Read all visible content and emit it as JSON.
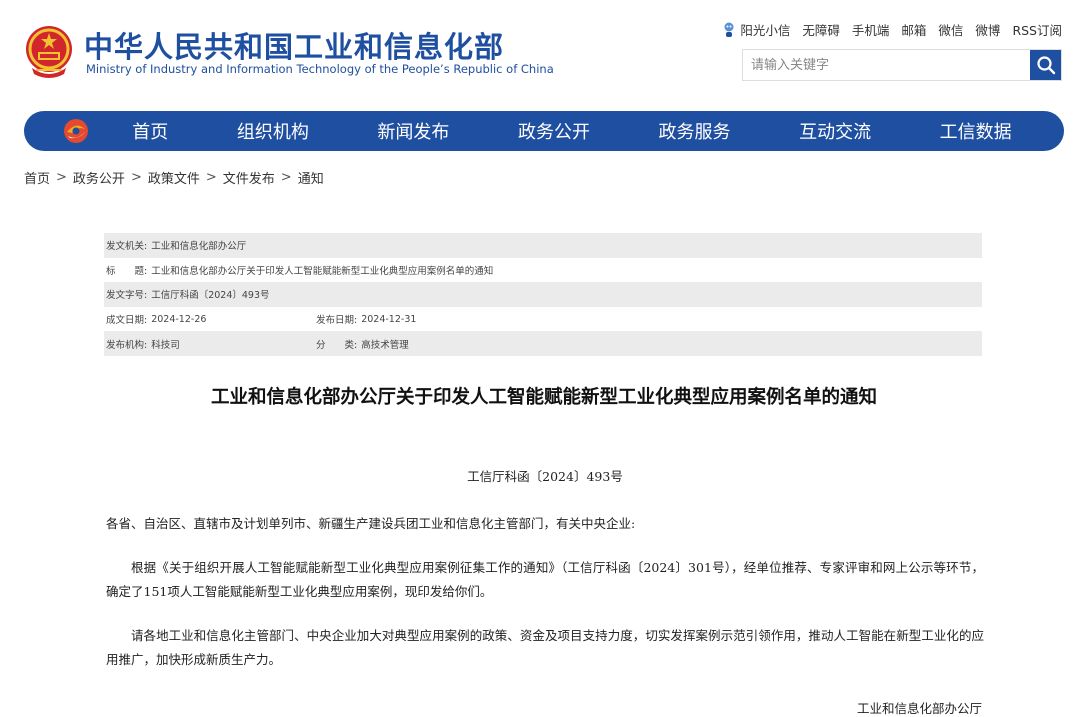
{
  "header": {
    "title": "中华人民共和国工业和信息化部",
    "subtitle": "Ministry of Industry and Information Technology of the People’s Republic of China",
    "top_links": [
      "阳光小信",
      "无障碍",
      "手机端",
      "邮箱",
      "微信",
      "微博",
      "RSS订阅"
    ],
    "search_placeholder": "请输入关键字",
    "brand_color": "#1f4fa0"
  },
  "nav": {
    "items": [
      "首页",
      "组织机构",
      "新闻发布",
      "政务公开",
      "政务服务",
      "互动交流",
      "工信数据"
    ]
  },
  "breadcrumb": [
    "首页",
    "政务公开",
    "政策文件",
    "文件发布",
    "通知"
  ],
  "meta": {
    "issuer_label": "发文机关:",
    "issuer": "工业和信息化部办公厅",
    "title_label": "标　　题:",
    "title": "工业和信息化部办公厅关于印发人工智能赋能新型工业化典型应用案例名单的通知",
    "doc_no_label": "发文字号:",
    "doc_no": "工信厅科函〔2024〕493号",
    "created_label": "成文日期:",
    "created": "2024-12-26",
    "published_label": "发布日期:",
    "published": "2024-12-31",
    "agency_label": "发布机构:",
    "agency": "科技司",
    "category_label": "分　　类:",
    "category": "高技术管理"
  },
  "document": {
    "title": "工业和信息化部办公厅关于印发人工智能赋能新型工业化典型应用案例名单的通知",
    "number": "工信厅科函〔2024〕493号",
    "salutation": "各省、自治区、直辖市及计划单列市、新疆生产建设兵团工业和信息化主管部门，有关中央企业:",
    "paragraphs": [
      "根据《关于组织开展人工智能赋能新型工业化典型应用案例征集工作的通知》（工信厅科函〔2024〕301号），经单位推荐、专家评审和网上公示等环节，确定了151项人工智能赋能新型工业化典型应用案例，现印发给你们。",
      "请各地工业和信息化主管部门、中央企业加大对典型应用案例的政策、资金及项目支持力度，切实发挥案例示范引领作用，推动人工智能在新型工业化的应用推广，加快形成新质生产力。"
    ],
    "signature": "工业和信息化部办公厅"
  },
  "icons": {
    "emblem": "national-emblem-icon",
    "sun": "sunshine-mascot-icon",
    "search": "search-icon",
    "nav_logo": "miit-logo-icon"
  }
}
